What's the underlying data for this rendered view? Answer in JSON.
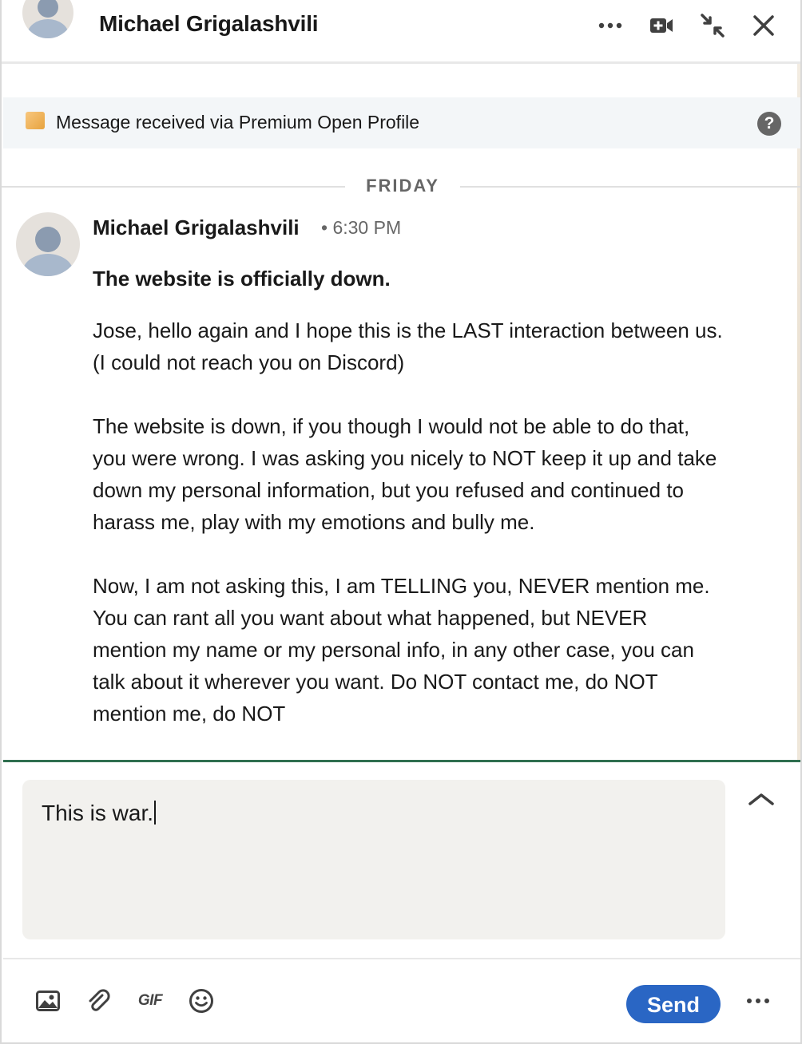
{
  "header": {
    "contact_name": "Michael Grigalashvili",
    "icons": [
      "more-options-icon",
      "video-call-icon",
      "minimize-icon",
      "close-icon"
    ]
  },
  "banner": {
    "text": "Message received via Premium Open Profile",
    "badge_color": "#E7A33E",
    "help_label": "?"
  },
  "conversation": {
    "day_label": "FRIDAY",
    "message": {
      "sender": "Michael Grigalashvili",
      "time": "• 6:30 PM",
      "subject": "The website is officially down.",
      "paragraphs": [
        "Jose, hello again and I hope this is the LAST interaction between us. (I could not reach you on Discord)",
        "The website is down, if you though I would not be able to do that, you were wrong. I was asking you nicely to NOT keep it up and take down my personal information, but you refused and continued to harass me, play with my emotions and bully me.",
        "Now, I am not asking this, I am TELLING you, NEVER mention me. You can rant all you want about what happened, but NEVER mention my name or my personal info, in any other case, you can talk about it wherever you want. Do NOT contact me, do NOT mention me, do NOT"
      ]
    }
  },
  "compose": {
    "value": "This is war."
  },
  "toolbar": {
    "gif_label": "GIF",
    "send_label": "Send",
    "send_color": "#2A66C4",
    "icons": [
      "image-icon",
      "attachment-icon",
      "gif-icon",
      "emoji-icon",
      "more-options-icon"
    ]
  }
}
